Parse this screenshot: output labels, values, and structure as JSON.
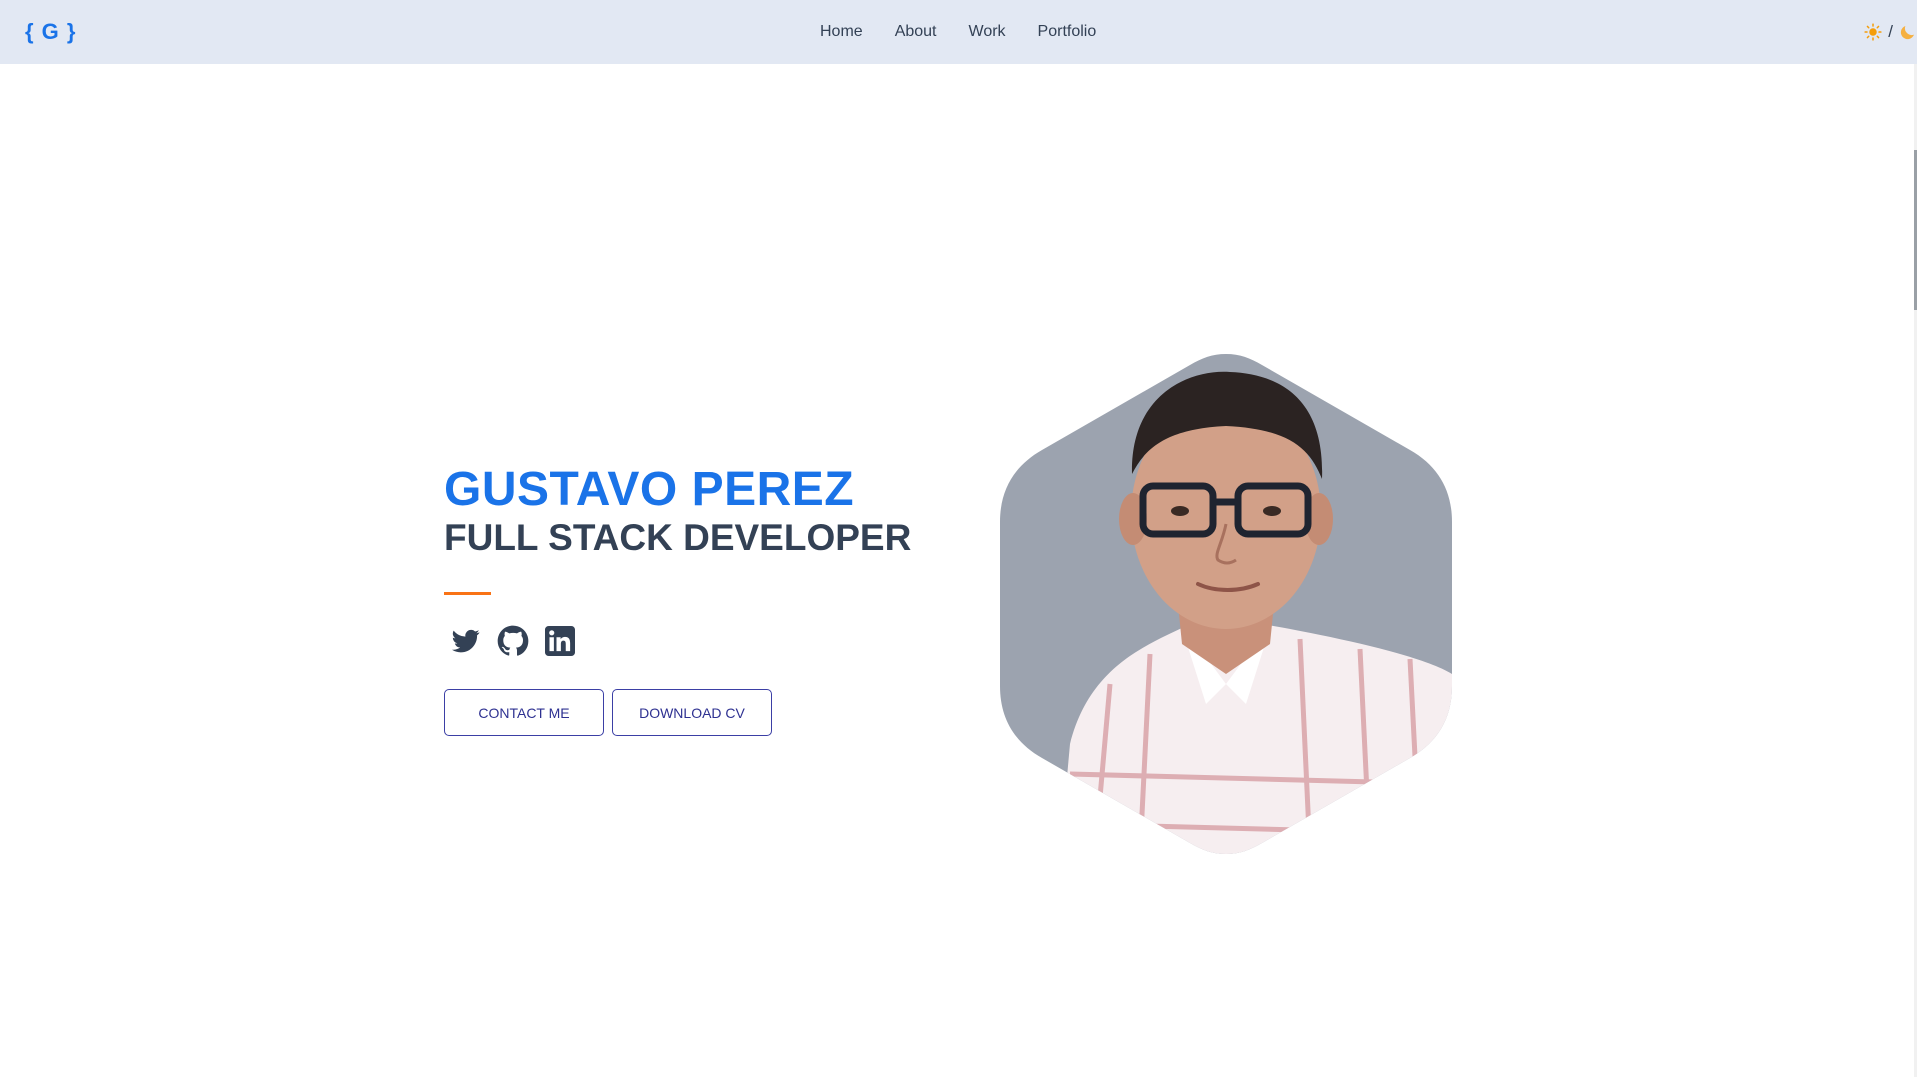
{
  "nav": {
    "logo": "{ G }",
    "links": [
      "Home",
      "About",
      "Work",
      "Portfolio"
    ],
    "theme_separator": "/",
    "theme_icons": [
      "sun-icon",
      "moon-icon"
    ]
  },
  "hero": {
    "name": "GUSTAVO PEREZ",
    "role": "FULL STACK DEVELOPER",
    "socials": [
      "twitter-icon",
      "github-icon",
      "linkedin-icon"
    ],
    "buttons": {
      "contact": "CONTACT ME",
      "download": "DOWNLOAD CV"
    }
  },
  "colors": {
    "accent": "#1a73e8",
    "text_dark": "#334155",
    "divider": "#f97316",
    "button_border": "#3b3fa5",
    "navbar_bg": "#e2e8f3",
    "portrait_bg": "#9ca3af"
  }
}
